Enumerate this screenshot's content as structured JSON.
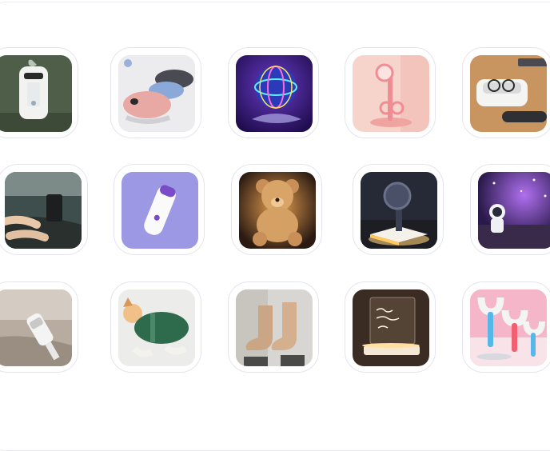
{
  "grid": {
    "products": [
      {
        "row": 1,
        "col": 1,
        "icon": "humidifier-icon",
        "colors": {
          "bg": "#4e5e48"
        }
      },
      {
        "row": 1,
        "col": 2,
        "icon": "slippers-icon",
        "colors": {
          "bg": "#ececef"
        }
      },
      {
        "row": 1,
        "col": 3,
        "icon": "flying-orb-icon",
        "colors": {
          "bg": "#3c1c74"
        }
      },
      {
        "row": 1,
        "col": 4,
        "icon": "eyelash-curler-icon",
        "colors": {
          "bg": "#f6d4cc"
        }
      },
      {
        "row": 1,
        "col": 5,
        "icon": "ultrasonic-cleaner-icon",
        "colors": {
          "bg": "#c89460"
        }
      },
      {
        "row": 2,
        "col": 1,
        "icon": "car-phone-mount-icon",
        "colors": {
          "bg": "#3e4e4c"
        }
      },
      {
        "row": 2,
        "col": 2,
        "icon": "hair-remover-icon",
        "colors": {
          "bg": "#9c98e4"
        }
      },
      {
        "row": 2,
        "col": 3,
        "icon": "teddy-bear-icon",
        "colors": {
          "bg": "#2a1a12"
        }
      },
      {
        "row": 2,
        "col": 4,
        "icon": "wireless-charger-icon",
        "colors": {
          "bg": "#262a36"
        }
      },
      {
        "row": 2,
        "col": 5,
        "icon": "galaxy-projector-icon",
        "colors": {
          "bg": "#4c2a6c"
        }
      },
      {
        "row": 3,
        "col": 1,
        "icon": "handheld-vacuum-icon",
        "colors": {
          "bg": "#b8aca0"
        }
      },
      {
        "row": 3,
        "col": 2,
        "icon": "dog-towel-icon",
        "colors": {
          "bg": "#ececea"
        }
      },
      {
        "row": 3,
        "col": 3,
        "icon": "snow-boots-icon",
        "colors": {
          "bg": "#d8d6d2"
        }
      },
      {
        "row": 3,
        "col": 4,
        "icon": "led-message-board-icon",
        "colors": {
          "bg": "#3a2c22"
        }
      },
      {
        "row": 3,
        "col": 5,
        "icon": "u-shaped-toothbrush-icon",
        "colors": {
          "bg": "#f4b6c8"
        }
      }
    ]
  }
}
